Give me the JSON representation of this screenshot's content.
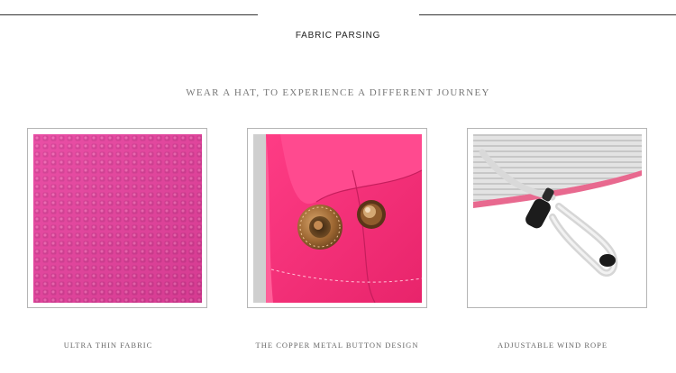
{
  "header": {
    "title": "FABRIC PARSING",
    "subtitle": "WEAR A HAT, TO EXPERIENCE A DIFFERENT JOURNEY"
  },
  "features": [
    {
      "caption": "ULTRA THIN FABRIC",
      "image_icon": "pink-fabric-texture"
    },
    {
      "caption": "THE COPPER METAL BUTTON DESIGN",
      "image_icon": "copper-snap-button"
    },
    {
      "caption": "ADJUSTABLE WIND ROPE",
      "image_icon": "wind-rope-cord-lock"
    }
  ],
  "colors": {
    "fabric_pink": "#ea3b9c",
    "hot_pink": "#ff2f7c",
    "copper": "#a8713b",
    "rope_grey": "#d9d9d9"
  }
}
